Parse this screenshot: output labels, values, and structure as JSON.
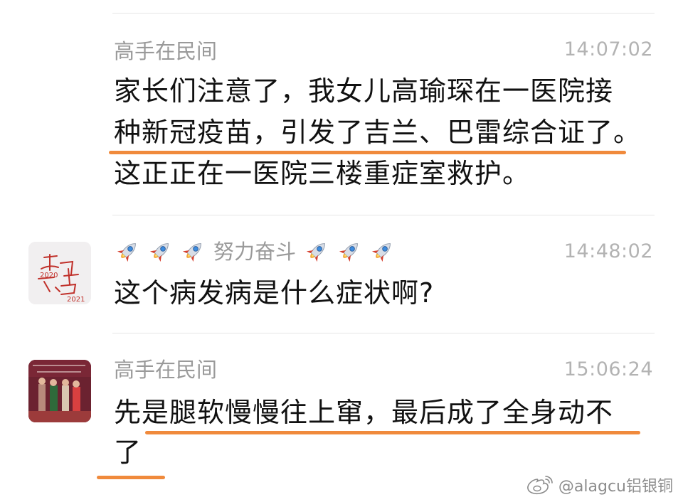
{
  "messages": [
    {
      "sender": "高手在民间",
      "time": "14:07:02",
      "lines": [
        "家长们注意了，我女儿高瑜琛在一医院接",
        "种新冠疫苗，引发了吉兰、巴雷综合证了。",
        "这正正在一医院三楼重症室救护。"
      ]
    },
    {
      "sender": "努力奋斗",
      "sender_decoration": "rocket-emoji x3 on each side",
      "time": "14:48:02",
      "avatar_text": [
        "一",
        "2020",
        "启",
        "程",
        "2021"
      ],
      "lines": [
        "这个病发病是什么症状啊?"
      ]
    },
    {
      "sender": "高手在民间",
      "time": "15:06:24",
      "lines": [
        "先是腿软慢慢往上窜，最后成了全身动不",
        "了"
      ]
    }
  ],
  "watermark": {
    "text": "@alagcu铝银铜",
    "icon": "weibo-icon"
  },
  "colors": {
    "underline": "#f08a3c",
    "sender": "#9a9a9a",
    "time": "#b3b3b3",
    "divider": "#e6e6e6"
  }
}
